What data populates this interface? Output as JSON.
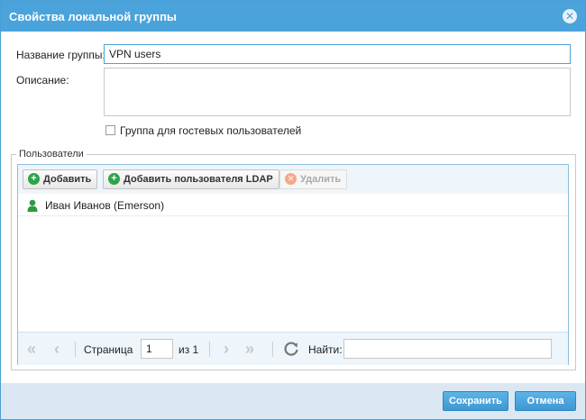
{
  "dialog": {
    "title": "Свойства локальной группы",
    "close_icon": "close-icon"
  },
  "form": {
    "group_name_label": "Название группы:",
    "group_name_value": "VPN users",
    "description_label": "Описание:",
    "description_value": "",
    "guest_checkbox_label": "Группа для гостевых пользователей",
    "guest_checkbox_checked": false
  },
  "users": {
    "legend": "Пользователи",
    "toolbar": {
      "add_label": "Добавить",
      "add_ldap_label": "Добавить пользователя LDAP",
      "delete_label": "Удалить"
    },
    "rows": [
      {
        "name": "Иван Иванов (Emerson)",
        "icon": "user-icon"
      }
    ],
    "pager": {
      "page_label": "Страница",
      "page_value": "1",
      "of_label": "из 1",
      "find_label": "Найти:",
      "find_value": ""
    }
  },
  "footer": {
    "save_label": "Сохранить",
    "cancel_label": "Отмена"
  },
  "colors": {
    "title_bar": "#4aa3da",
    "accent": "#3e98d3",
    "add_icon": "#2ea44a",
    "delete_icon_disabled": "#f3a98a",
    "user_icon": "#2e9a3f"
  }
}
